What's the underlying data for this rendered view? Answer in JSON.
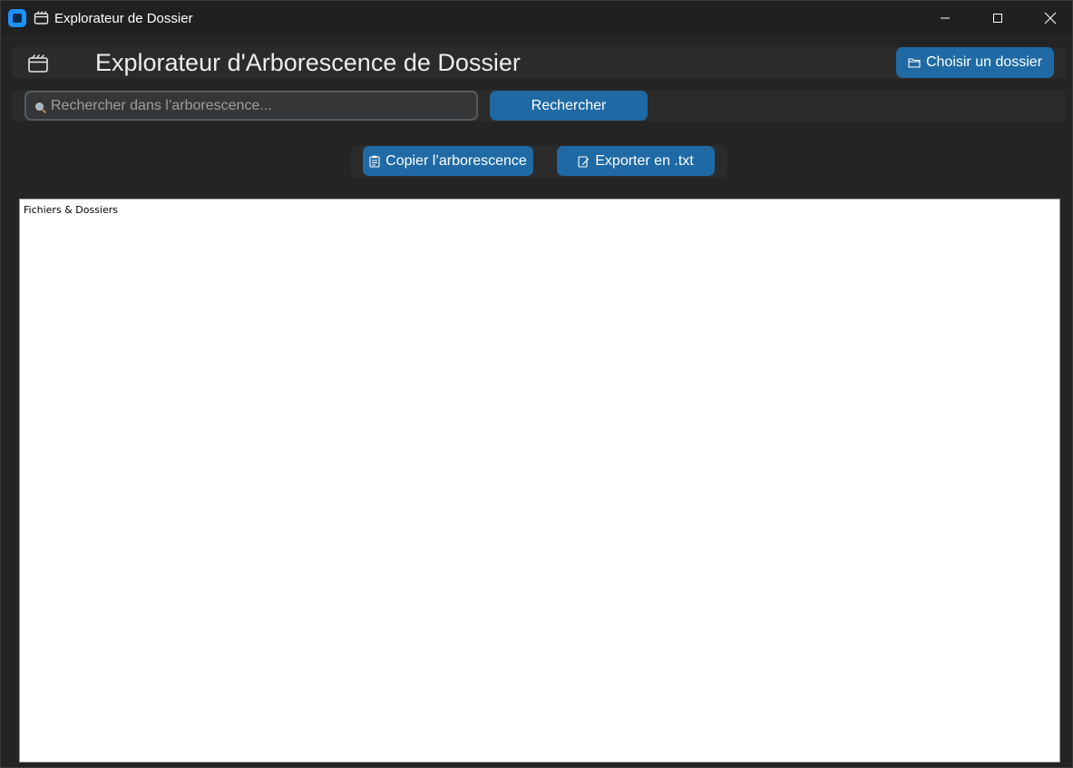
{
  "window": {
    "title": "Explorateur de Dossier"
  },
  "header": {
    "title": "Explorateur d'Arborescence de Dossier",
    "choose_folder_label": "Choisir un dossier"
  },
  "search": {
    "placeholder": "Rechercher dans l’arborescence...",
    "value": "",
    "button_label": "Rechercher"
  },
  "actions": {
    "copy_label": "Copier l’arborescence",
    "export_label": "Exporter en .txt"
  },
  "tree": {
    "header": "Fichiers & Dossiers",
    "items": []
  },
  "colors": {
    "accent": "#1f6aa5",
    "background": "#242424",
    "panel": "#2b2b2b",
    "app_icon": "#1e90ff"
  },
  "icons": {
    "app": "app-icon",
    "title": "clapper-folder-icon",
    "header": "clapper-folder-icon",
    "choose": "folder-icon",
    "search": "magnifier-icon",
    "copy": "clipboard-icon",
    "export": "edit-document-icon"
  }
}
